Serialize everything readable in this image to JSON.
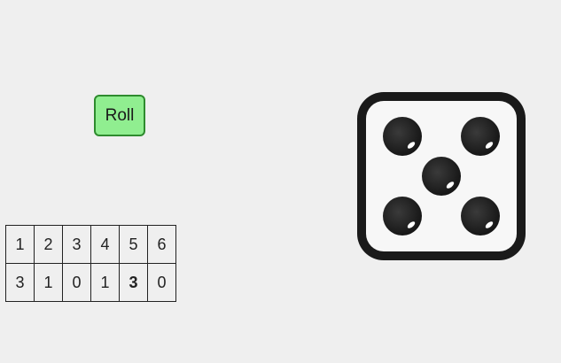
{
  "roll_button": {
    "label": "Roll"
  },
  "table": {
    "faces": [
      "1",
      "2",
      "3",
      "4",
      "5",
      "6"
    ],
    "counts": [
      "3",
      "1",
      "0",
      "1",
      "3",
      "0"
    ],
    "highlighted_face": 5
  },
  "die": {
    "value": 5,
    "colors": {
      "frame": "#1a1a1a",
      "face": "#f7f7f7",
      "pip": "#1a1a1a",
      "highlight": "#ffffff"
    }
  },
  "colors": {
    "background": "#efefef",
    "button_fill": "#90ee90",
    "button_border": "#2e8b2e"
  }
}
